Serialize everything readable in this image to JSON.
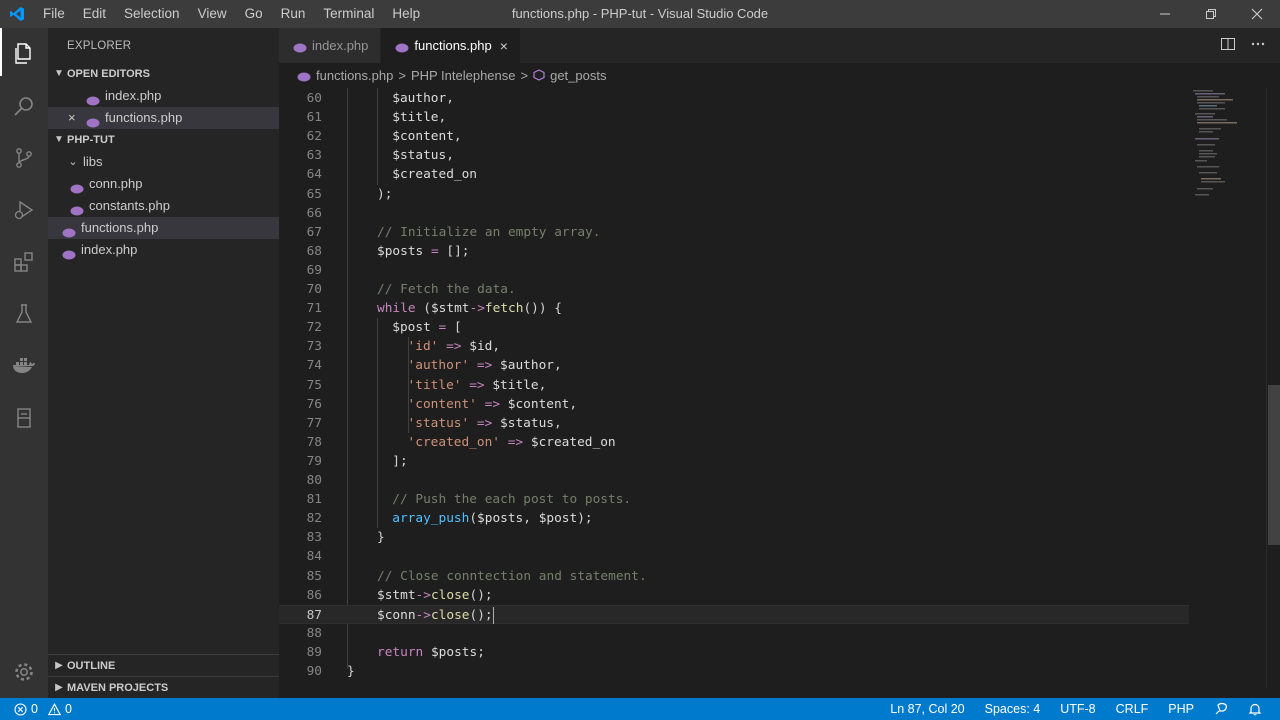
{
  "window": {
    "title": "functions.php - PHP-tut - Visual Studio Code",
    "menu": [
      "File",
      "Edit",
      "Selection",
      "View",
      "Go",
      "Run",
      "Terminal",
      "Help"
    ]
  },
  "activity_icons": [
    "explorer-icon",
    "search-icon",
    "source-control-icon",
    "run-debug-icon",
    "extensions-icon",
    "testing-icon",
    "docker-icon",
    "database-icon"
  ],
  "sidebar": {
    "title": "EXPLORER",
    "open_editors": {
      "label": "OPEN EDITORS",
      "items": [
        {
          "name": "index.php"
        },
        {
          "name": "functions.php",
          "close": "×"
        }
      ]
    },
    "project": {
      "label": "PHP-TUT",
      "folder": "libs",
      "folder_items": [
        "conn.php",
        "constants.php"
      ],
      "root_items": [
        "functions.php",
        "index.php"
      ]
    },
    "outline_label": "OUTLINE",
    "maven_label": "MAVEN PROJECTS"
  },
  "tabs": [
    {
      "label": "index.php"
    },
    {
      "label": "functions.php",
      "close": "×"
    }
  ],
  "breadcrumbs": {
    "file": "functions.php",
    "sep": ">",
    "ext": "PHP Intelephense",
    "symbol": "get_posts"
  },
  "code_lines": [
    {
      "n": "60",
      "html": "            <span class='t-var'>$author</span>,"
    },
    {
      "n": "61",
      "html": "            <span class='t-var'>$title</span>,"
    },
    {
      "n": "62",
      "html": "            <span class='t-var'>$content</span>,"
    },
    {
      "n": "63",
      "html": "            <span class='t-var'>$status</span>,"
    },
    {
      "n": "64",
      "html": "            <span class='t-var'>$created_on</span>"
    },
    {
      "n": "65",
      "html": "        );"
    },
    {
      "n": "66",
      "html": ""
    },
    {
      "n": "67",
      "html": "        <span class='t-cm'>// Initialize an empty array.</span>"
    },
    {
      "n": "68",
      "html": "        <span class='t-var'>$posts</span> <span class='t-arrow'>=</span> [];"
    },
    {
      "n": "69",
      "html": ""
    },
    {
      "n": "70",
      "html": "        <span class='t-cm'>// Fetch the data.</span>"
    },
    {
      "n": "71",
      "html": "        <span class='t-kw'>while</span> (<span class='t-var'>$stmt</span><span class='t-arrow'>-&gt;</span><span class='t-fn'>fetch</span>()) {"
    },
    {
      "n": "72",
      "html": "            <span class='t-var'>$post</span> <span class='t-arrow'>=</span> ["
    },
    {
      "n": "73",
      "html": "                <span class='t-str'>'id'</span> <span class='t-arrow'>=&gt;</span> <span class='t-var'>$id</span>,"
    },
    {
      "n": "74",
      "html": "                <span class='t-str'>'author'</span> <span class='t-arrow'>=&gt;</span> <span class='t-var'>$author</span>,"
    },
    {
      "n": "75",
      "html": "                <span class='t-str'>'title'</span> <span class='t-arrow'>=&gt;</span> <span class='t-var'>$title</span>,"
    },
    {
      "n": "76",
      "html": "                <span class='t-str'>'content'</span> <span class='t-arrow'>=&gt;</span> <span class='t-var'>$content</span>,"
    },
    {
      "n": "77",
      "html": "                <span class='t-str'>'status'</span> <span class='t-arrow'>=&gt;</span> <span class='t-var'>$status</span>,"
    },
    {
      "n": "78",
      "html": "                <span class='t-str'>'created_on'</span> <span class='t-arrow'>=&gt;</span> <span class='t-var'>$created_on</span>"
    },
    {
      "n": "79",
      "html": "            ];"
    },
    {
      "n": "80",
      "html": ""
    },
    {
      "n": "81",
      "html": "            <span class='t-cm'>// Push the each post to posts.</span>"
    },
    {
      "n": "82",
      "html": "            <span class='t-bi'>array_push</span>(<span class='t-var'>$posts</span>, <span class='t-var'>$post</span>);"
    },
    {
      "n": "83",
      "html": "        }"
    },
    {
      "n": "84",
      "html": ""
    },
    {
      "n": "85",
      "html": "        <span class='t-cm'>// Close conntection and statement.</span>"
    },
    {
      "n": "86",
      "html": "        <span class='t-var'>$stmt</span><span class='t-arrow'>-&gt;</span><span class='t-fn'>close</span>();"
    },
    {
      "n": "87",
      "html": "        <span class='t-var'>$conn</span><span class='t-arrow'>-&gt;</span><span class='t-fn'>close</span>();"
    },
    {
      "n": "88",
      "html": ""
    },
    {
      "n": "89",
      "html": "        <span class='t-kw'>return</span> <span class='t-var'>$posts</span>;"
    },
    {
      "n": "90",
      "html": "    }"
    }
  ],
  "current_line": "87",
  "status": {
    "errors": "0",
    "warnings": "0",
    "position": "Ln 87, Col 20",
    "spaces": "Spaces: 4",
    "encoding": "UTF-8",
    "eol": "CRLF",
    "language": "PHP"
  },
  "colors": {
    "accent": "#007acc",
    "php_icon": "#a074c4"
  }
}
